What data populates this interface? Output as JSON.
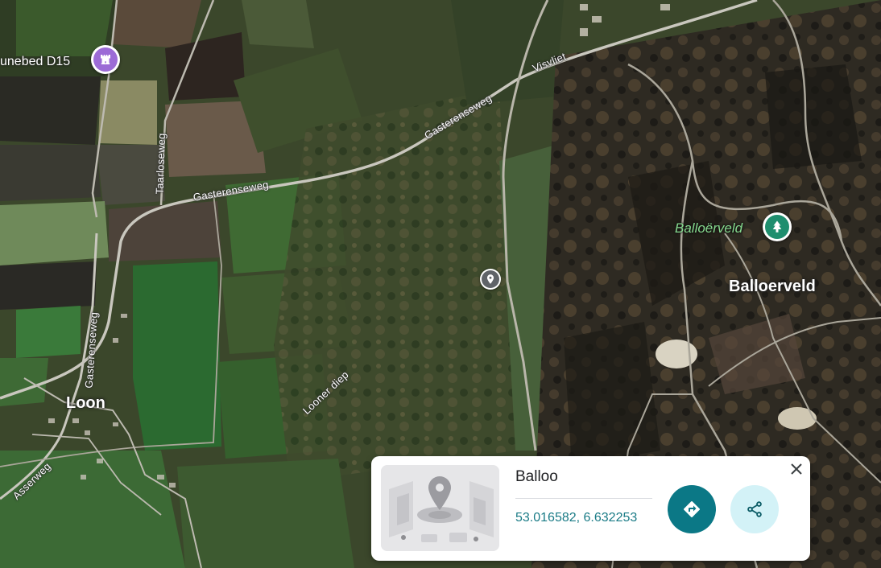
{
  "map": {
    "road_labels": {
      "gasterenseweg_west": "Gasterenseweg",
      "gasterenseweg_east": "Gasterenseweg",
      "visvliet": "Visvliet",
      "taarloseweg": "Taarloseweg",
      "gasterenseweg_south": "Gasterenseweg",
      "asserweg": "Asserweg",
      "looner_diep": "Looner diep"
    },
    "place_labels": {
      "loon": "Loon",
      "balloerveld": "Balloerveld"
    },
    "poi_labels": {
      "hunebed": "unebed D15",
      "balloerveld_park": "Balloërveld"
    },
    "icons": {
      "hunebed_pin": "castle-icon",
      "park_pin": "tree-icon",
      "dropped_pin": "location-pin-icon"
    },
    "colors": {
      "hunebed_pin": "#9c6bd6",
      "park_pin": "#1e8e6e",
      "park_label": "#86d98e"
    }
  },
  "card": {
    "title": "Balloo",
    "coordinates": "53.016582, 6.632253",
    "thumbnail_icon": "location-pin-icon",
    "directions_icon": "directions-icon",
    "share_icon": "share-icon",
    "close_icon": "close-icon",
    "colors": {
      "directions_button": "#0b7886",
      "share_button": "#d3f2f7",
      "coordinates_text": "#1a7b86"
    }
  }
}
